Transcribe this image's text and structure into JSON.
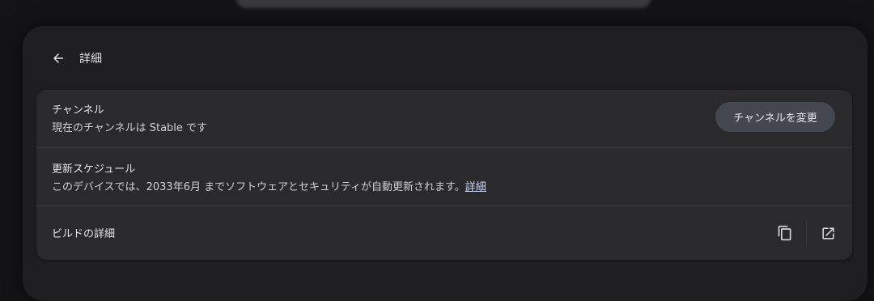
{
  "header": {
    "title": "詳細",
    "back_icon": "arrow-left-icon"
  },
  "channel": {
    "title": "チャンネル",
    "subtitle": "現在のチャンネルは Stable です",
    "button_label": "チャンネルを変更"
  },
  "schedule": {
    "title": "更新スケジュール",
    "subtitle": "このデバイスでは、2033年6月 までソフトウェアとセキュリティが自動更新されます。",
    "link_label": "詳細"
  },
  "build": {
    "title": "ビルドの詳細",
    "copy_icon": "copy-icon",
    "open_icon": "open-in-new-icon"
  },
  "colors": {
    "background": "#141416",
    "panel": "#1f1f21",
    "card": "#2a2a2d",
    "button": "#434750",
    "link": "#c8d6f5"
  }
}
